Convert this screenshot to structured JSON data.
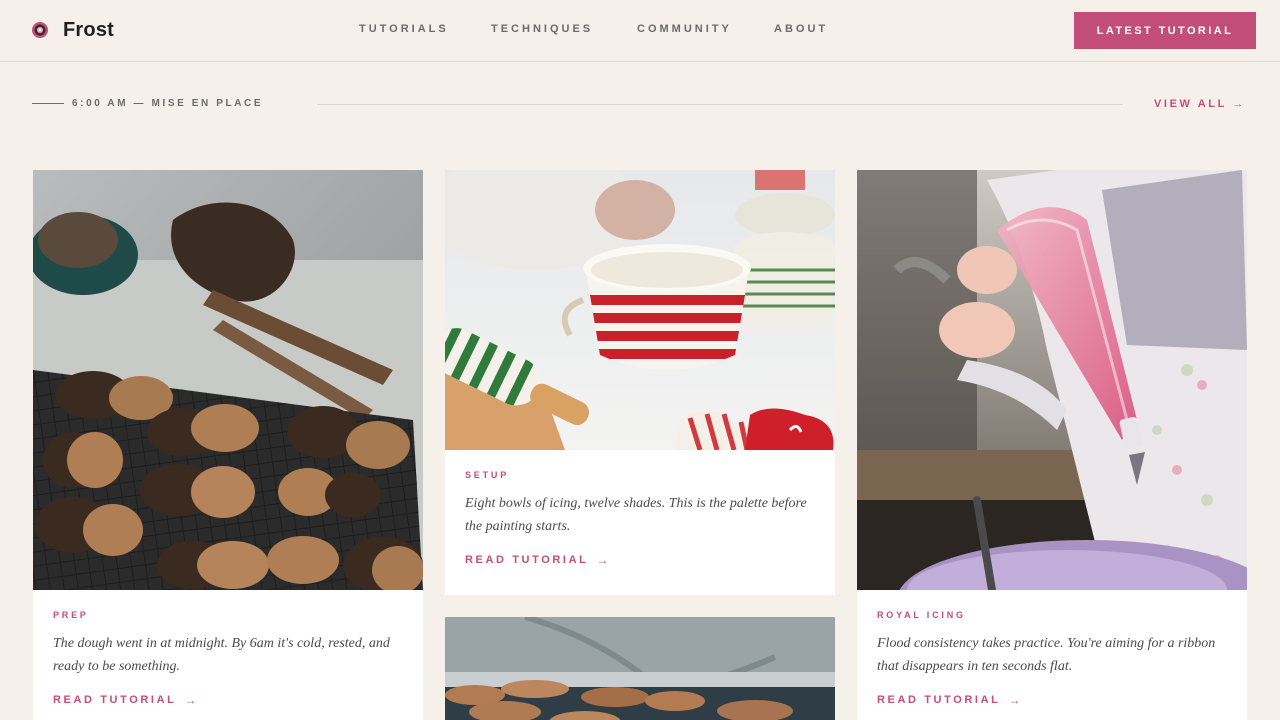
{
  "header": {
    "brand": "Frost",
    "brand_icon": "donut-icon",
    "nav": [
      "TUTORIALS",
      "TECHNIQUES",
      "COMMUNITY",
      "ABOUT"
    ],
    "cta_label": "LATEST TUTORIAL"
  },
  "section": {
    "label": "6:00 AM — MISE EN PLACE",
    "view_all": "VIEW ALL →"
  },
  "cards": [
    {
      "tag": "PREP",
      "excerpt": "The dough went in at midnight. By 6am it's cold, rested, and ready to be something.",
      "read_label": "READ TUTORIAL",
      "arrow": "→"
    },
    {
      "tag": "SETUP",
      "excerpt": "Eight bowls of icing, twelve shades. This is the palette before the painting starts.",
      "read_label": "READ TUTORIAL",
      "arrow": "→"
    },
    {
      "tag": "ROYAL ICING",
      "excerpt": "Flood consistency takes practice. You're aiming for a ribbon that disappears in ten seconds flat.",
      "read_label": "READ TUTORIAL",
      "arrow": "→"
    }
  ],
  "colors": {
    "accent": "#c24e77",
    "background": "#f5f0ea",
    "card": "#ffffff"
  }
}
